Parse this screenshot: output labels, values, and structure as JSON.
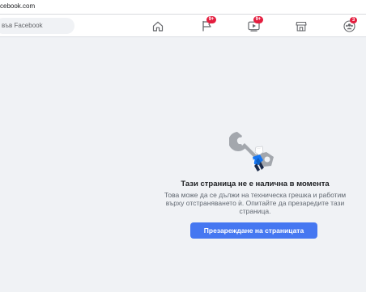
{
  "browser": {
    "url": "cebook.com"
  },
  "header": {
    "search": {
      "placeholder": "във Facebook"
    },
    "nav": {
      "home": {
        "icon": "home-icon"
      },
      "pages": {
        "icon": "flag-icon",
        "badge": "9+"
      },
      "watch": {
        "icon": "video-icon",
        "badge": "9+"
      },
      "marketplace": {
        "icon": "marketplace-icon"
      },
      "groups": {
        "icon": "groups-icon",
        "badge": "3"
      }
    }
  },
  "error": {
    "illustration": "wrench-and-broken-connector-illustration",
    "title": "Тази страница не е налична в момента",
    "description": "Това може да се дължи на техническа грешка и работим върху отстраняването ѝ. Опитайте да презаредите тази страница.",
    "reload_label": "Презареждане на страницата"
  },
  "colors": {
    "background": "#f0f2f5",
    "accent": "#4577f1",
    "badge": "#e41e3f"
  }
}
